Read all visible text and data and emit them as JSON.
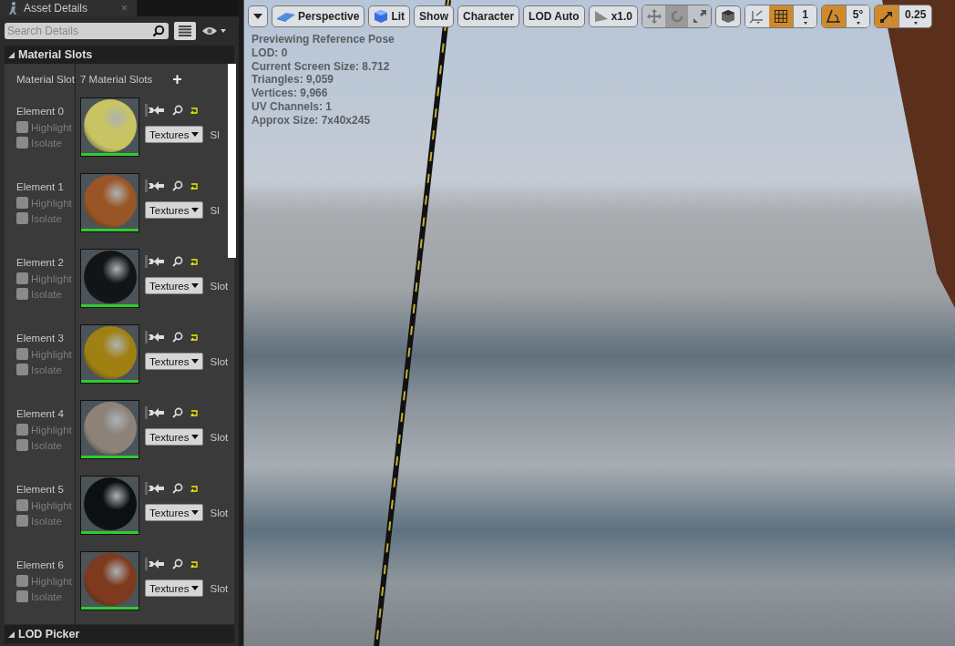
{
  "panel_tab": {
    "title": "Asset Details",
    "close": "×"
  },
  "search": {
    "placeholder": "Search Details"
  },
  "material_slots": {
    "title": "Material Slots",
    "expanded": true,
    "label": "Material Slot",
    "count": "7 Material Slots",
    "add": "+",
    "elements": [
      {
        "name": "Element 0",
        "highlight": {
          "label": "Highlight",
          "checked": false
        },
        "isolate": {
          "label": "Isolate",
          "checked": false
        },
        "color": "#c9c463",
        "dropdown": "Textures",
        "slot": "Sl"
      },
      {
        "name": "Element 1",
        "highlight": {
          "label": "Highlight",
          "checked": false
        },
        "isolate": {
          "label": "Isolate",
          "checked": false
        },
        "color": "#9a5526",
        "dropdown": "Textures",
        "slot": "Sl"
      },
      {
        "name": "Element 2",
        "highlight": {
          "label": "Highlight",
          "checked": false
        },
        "isolate": {
          "label": "Isolate",
          "checked": false
        },
        "color": "#121416",
        "dropdown": "Textures",
        "slot": "Slot"
      },
      {
        "name": "Element 3",
        "highlight": {
          "label": "Highlight",
          "checked": false
        },
        "isolate": {
          "label": "Isolate",
          "checked": false
        },
        "color": "#a08012",
        "dropdown": "Textures",
        "slot": "Slot"
      },
      {
        "name": "Element 4",
        "highlight": {
          "label": "Highlight",
          "checked": false
        },
        "isolate": {
          "label": "Isolate",
          "checked": false
        },
        "color": "#8c8278",
        "dropdown": "Textures",
        "slot": "Slot"
      },
      {
        "name": "Element 5",
        "highlight": {
          "label": "Highlight",
          "checked": false
        },
        "isolate": {
          "label": "Isolate",
          "checked": false
        },
        "color": "#0e0f10",
        "dropdown": "Textures",
        "slot": "Slot"
      },
      {
        "name": "Element 6",
        "highlight": {
          "label": "Highlight",
          "checked": false
        },
        "isolate": {
          "label": "Isolate",
          "checked": false
        },
        "color": "#7e3a1e",
        "dropdown": "Textures",
        "slot": "Slot"
      }
    ]
  },
  "lod_picker": {
    "title": "LOD Picker",
    "expanded": true
  },
  "viewport": {
    "toolbar": {
      "view_mode": {
        "label": "Perspective"
      },
      "lighting": {
        "label": "Lit"
      },
      "show": {
        "label": "Show"
      },
      "character": {
        "label": "Character"
      },
      "lod": {
        "label": "LOD Auto"
      },
      "speed": {
        "label": "x1.0"
      },
      "transform_modes": [
        {
          "selected": false
        },
        {
          "selected": true
        },
        {
          "selected": false
        }
      ],
      "grid_snap": {
        "on": true,
        "value": "1"
      },
      "rotation_snap": {
        "on": true,
        "value": "5°"
      },
      "scale_snap": {
        "on": true,
        "value": "0.25"
      }
    },
    "stats": [
      "Previewing Reference Pose",
      "LOD: 0",
      "Current Screen Size: 8.712",
      "Triangles: 9,059",
      "Vertices: 9,966",
      "UV Channels: 1",
      "Approx Size: 7x40x245"
    ]
  }
}
